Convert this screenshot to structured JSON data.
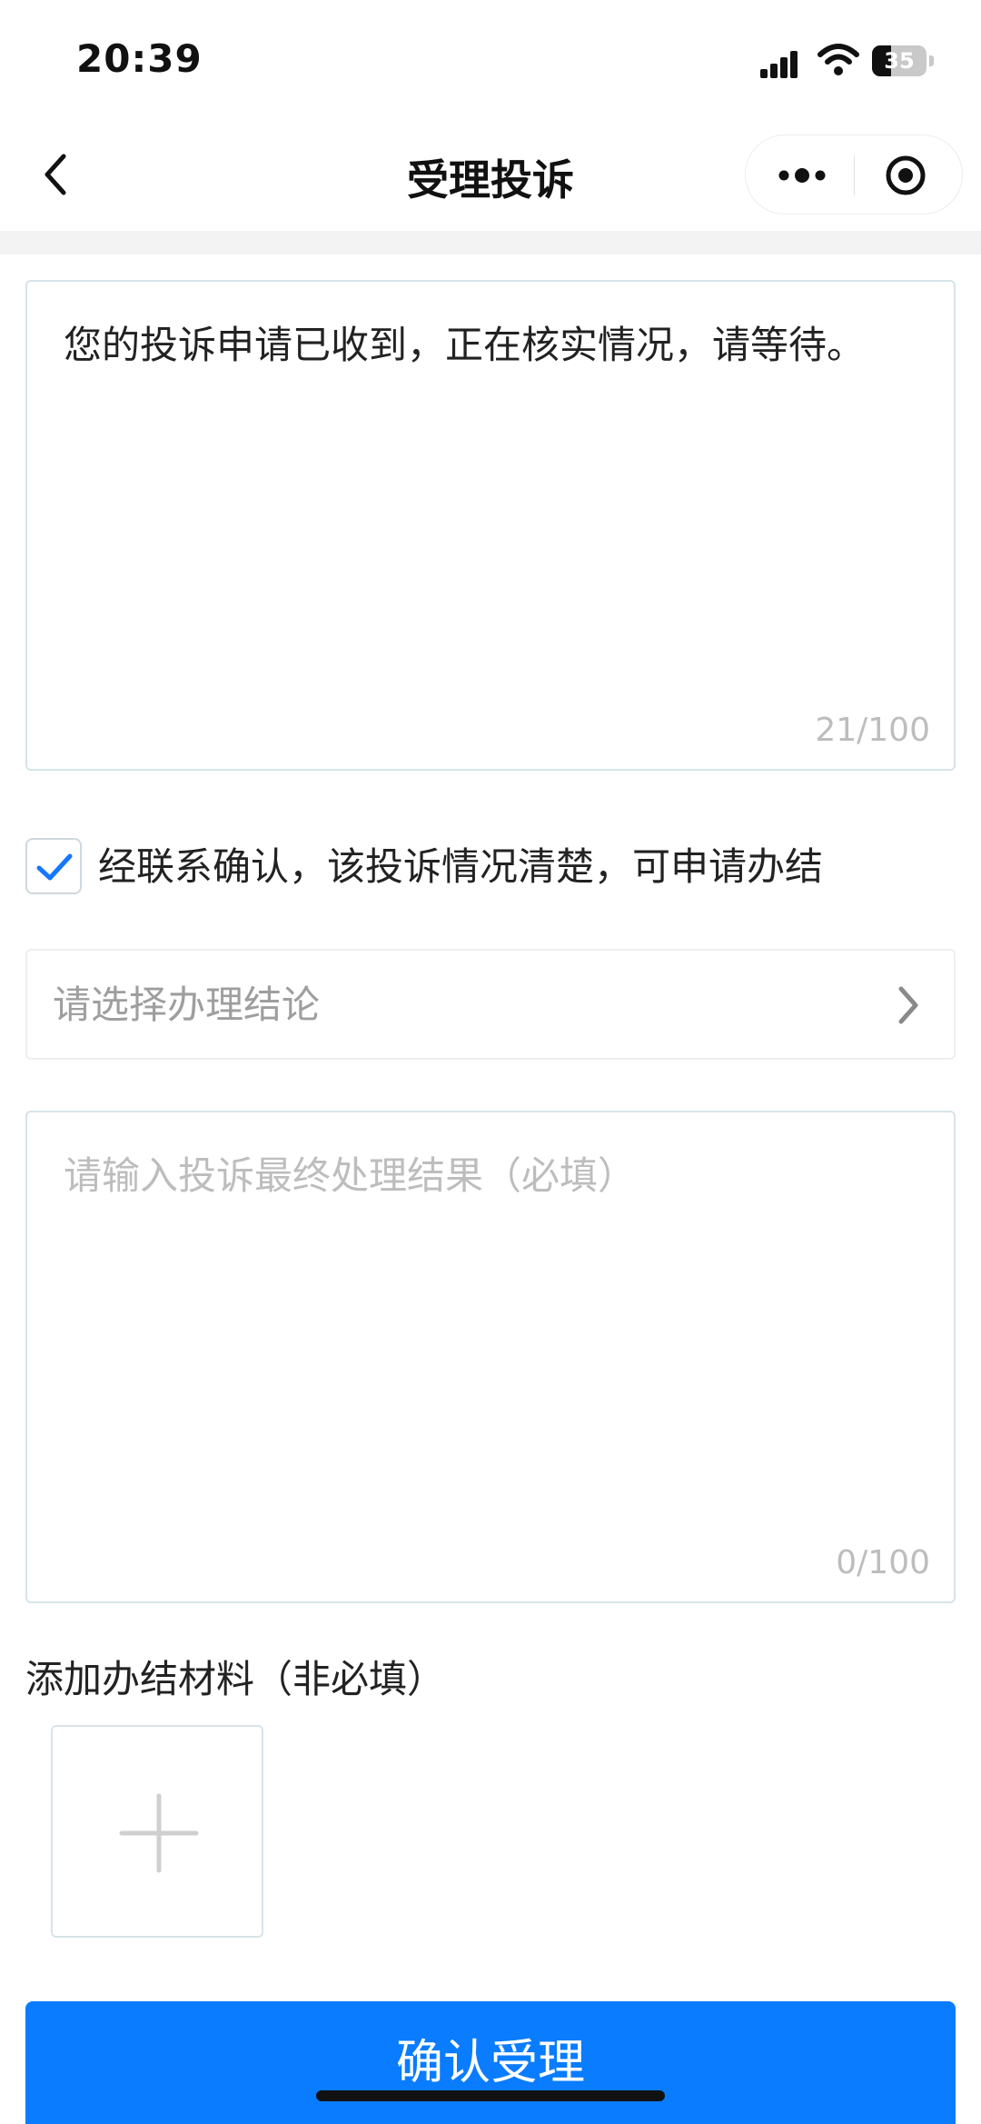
{
  "status_bar": {
    "time": "20:39",
    "battery_level": "35"
  },
  "nav": {
    "title": "受理投诉"
  },
  "reply": {
    "value": "您的投诉申请已收到，正在核实情况，请等待。",
    "counter": "21/100"
  },
  "close_check": {
    "checked": true,
    "label": "经联系确认，该投诉情况清楚，可申请办结"
  },
  "conclusion_select": {
    "placeholder": "请选择办理结论"
  },
  "result": {
    "placeholder": "请输入投诉最终处理结果（必填）",
    "counter": "0/100"
  },
  "attachments": {
    "label": "添加办结材料（非必填）"
  },
  "confirm_button": {
    "label": "确认受理"
  },
  "colors": {
    "primary": "#0a7cff",
    "check": "#1677ff",
    "placeholder": "#bdbdbd",
    "border": "#d6e3ea"
  },
  "icons": [
    "signal-icon",
    "wifi-icon",
    "battery-icon",
    "back-arrow-icon",
    "more-dots-icon",
    "record-target-icon",
    "checkmark-icon",
    "chevron-right-icon",
    "plus-icon"
  ]
}
